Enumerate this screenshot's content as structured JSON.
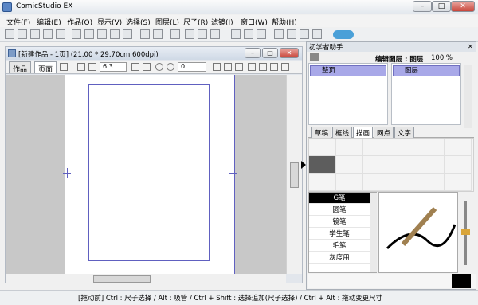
{
  "app": {
    "title": "ComicStudio EX"
  },
  "window_buttons": {
    "min": "–",
    "max": "□",
    "close": "✕"
  },
  "menu": [
    "文件(F)",
    "编辑(E)",
    "作品(O)",
    "显示(V)",
    "选择(S)",
    "图层(L)",
    "尺子(R)",
    "滤镜(I)",
    "窗口(W)",
    "帮助(H)"
  ],
  "document": {
    "title": "[新建作品 - 1页] (21.00 * 29.70cm 600dpi)",
    "tabs": [
      "作品",
      "页面"
    ],
    "zoom": "6.3",
    "rotation": "0"
  },
  "panel": {
    "title": "初学者助手",
    "edit_layer_label": "编辑图层 : 图层",
    "zoom": "100 %",
    "tree_item": "整页",
    "layer_item": "图层",
    "tabs": [
      "草稿",
      "框线",
      "描画",
      "网点",
      "文字"
    ],
    "pens": [
      "G笔",
      "圆笔",
      "镜笔",
      "学生笔",
      "毛笔",
      "灰度用"
    ],
    "selected_pen": 0
  },
  "status": {
    "text": "[拖动前] Ctrl : 尺子选择 / Alt : 吸管 / Ctrl + Shift : 选择追加(尺子选择) / Ctrl + Alt : 拖动变更尺寸"
  },
  "colors": {
    "selection": "#a8a8e8",
    "frame": "#6060c0",
    "black_swatch": "#000000"
  }
}
